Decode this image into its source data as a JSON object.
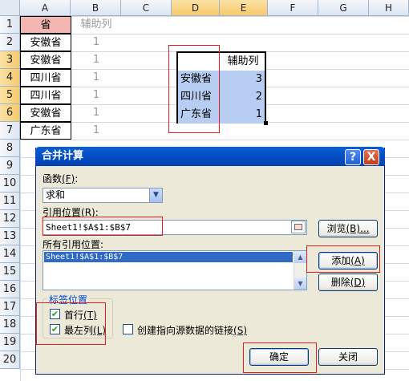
{
  "columns": [
    "A",
    "B",
    "C",
    "D",
    "E",
    "F",
    "G",
    "H"
  ],
  "rows": [
    "1",
    "2",
    "3",
    "4",
    "5",
    "6",
    "7",
    "8",
    "9",
    "10",
    "11",
    "12",
    "13",
    "14",
    "15",
    "16",
    "17",
    "18",
    "19",
    "20"
  ],
  "colA": [
    "省",
    "安徽省",
    "安徽省",
    "四川省",
    "四川省",
    "安徽省",
    "广东省"
  ],
  "colB_header": "辅助列",
  "colB": [
    "1",
    "1",
    "1",
    "1",
    "1",
    "1"
  ],
  "result_table": {
    "header": "辅助列",
    "rows": [
      {
        "name": "安徽省",
        "value": "3"
      },
      {
        "name": "四川省",
        "value": "2"
      },
      {
        "name": "广东省",
        "value": "1"
      }
    ]
  },
  "colors": {
    "header_fill": "#f4b6b0",
    "selection_fill": "#b7cef2",
    "highlight_border": "#e02020"
  },
  "dialog": {
    "title": "合并计算",
    "help_label": "?",
    "close_label": "X",
    "function_label": "函数",
    "function_key": "(F)",
    "function_value": "求和",
    "reference_label": "引用位置",
    "reference_key": "(R)",
    "reference_value": "Sheet1!$A$1:$B$7",
    "browse_button": "浏览",
    "browse_key": "(B)...",
    "all_refs_label": "所有引用位置:",
    "all_refs_items": [
      "Sheet1!$A$1:$B$7"
    ],
    "add_button": "添加",
    "add_key": "(A)",
    "delete_button": "删除",
    "delete_key": "(D)",
    "label_position_title": "标签位置",
    "first_row_label": "首行",
    "first_row_key": "(T)",
    "left_column_label": "最左列",
    "left_column_key": "(L)",
    "link_label": "创建指向源数据的链接",
    "link_key": "(S)",
    "ok_button": "确定",
    "cancel_button": "关闭",
    "first_row_checked": true,
    "left_column_checked": true,
    "link_checked": false
  }
}
